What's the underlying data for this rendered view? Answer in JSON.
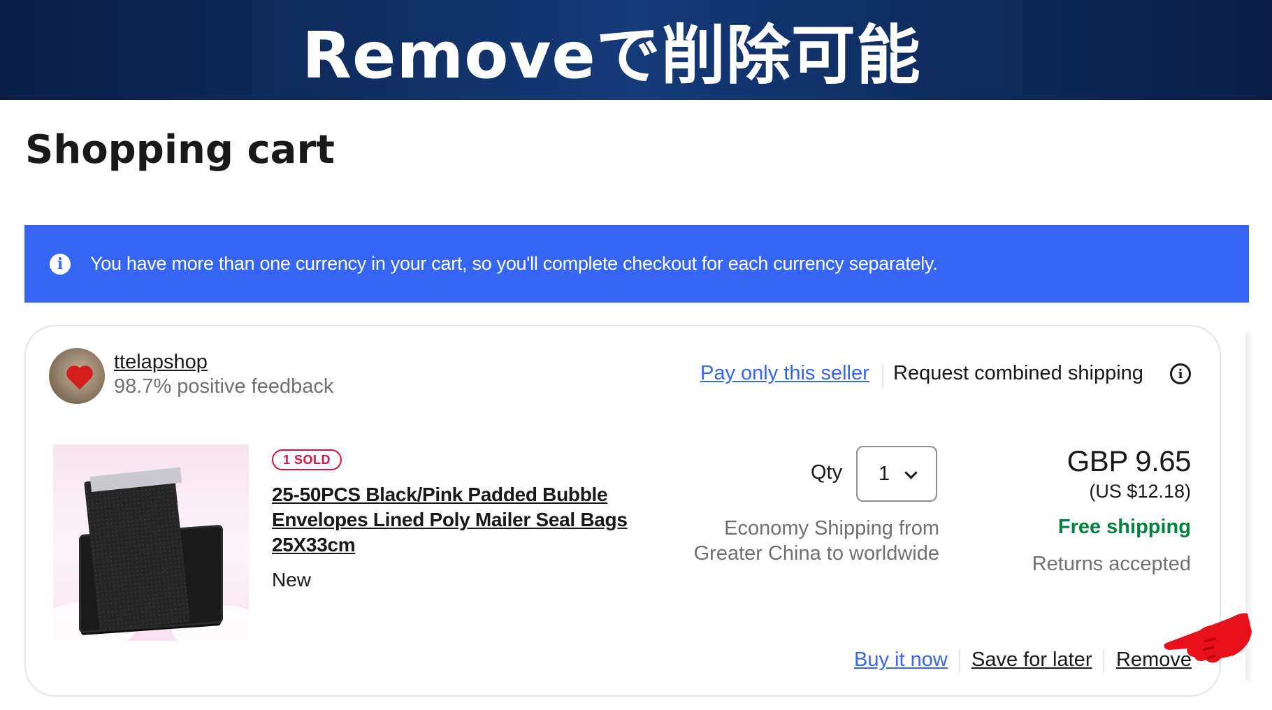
{
  "banner": {
    "text": "Removeで削除可能"
  },
  "page_title": "Shopping cart",
  "notice": {
    "text": "You have more than one currency in your cart, so you'll complete checkout for each currency separately.",
    "icon": "info-icon"
  },
  "seller": {
    "name": "ttelapshop",
    "feedback": "98.7% positive feedback",
    "pay_only_label": "Pay only this seller",
    "request_combined_label": "Request combined shipping"
  },
  "item": {
    "sold_badge": "1 SOLD",
    "title": "25-50PCS Black/Pink Padded Bubble Envelopes Lined Poly Mailer Seal Bags 25X33cm",
    "condition": "New",
    "qty_label": "Qty",
    "qty_value": "1",
    "shipping_method": "Economy Shipping from Greater China to worldwide",
    "price": "GBP 9.65",
    "price_usd": "(US $12.18)",
    "free_shipping": "Free shipping",
    "returns": "Returns accepted"
  },
  "actions": {
    "buy_now": "Buy it now",
    "save_for_later": "Save for later",
    "remove": "Remove"
  },
  "colors": {
    "banner": "#143a78",
    "accent_blue": "#3665f3",
    "free_shipping_green": "#05823f",
    "sold_red": "#e0103a",
    "pointer_red": "#e8101a"
  }
}
